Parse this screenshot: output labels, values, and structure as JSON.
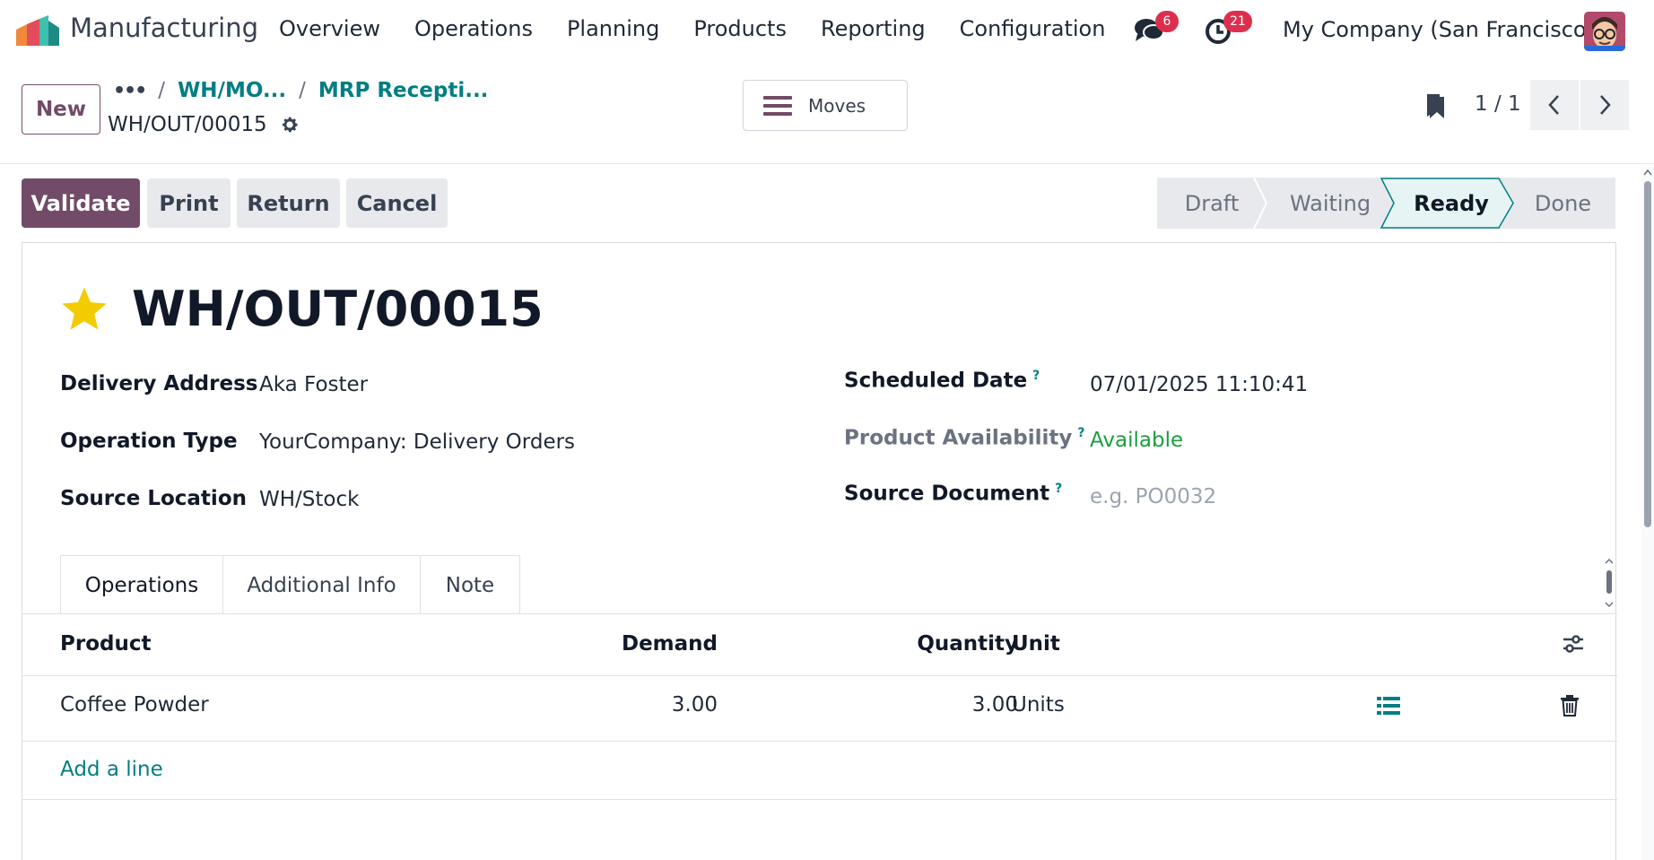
{
  "navbar": {
    "app_name": "Manufacturing",
    "menu": [
      "Overview",
      "Operations",
      "Planning",
      "Products",
      "Reporting",
      "Configuration"
    ],
    "messages_count": "6",
    "activities_count": "21",
    "company": "My Company (San Francisco)",
    "icons": {
      "logo": "manufacturing-logo-icon",
      "messages": "chat-bubbles-icon",
      "activities": "clock-icon"
    }
  },
  "control_panel": {
    "new_label": "New",
    "breadcrumb": {
      "dots": "•••",
      "crumbs": [
        "WH/MO...",
        "MRP Recepti..."
      ]
    },
    "record_name": "WH/OUT/00015",
    "moves_label": "Moves",
    "pager": "1 / 1"
  },
  "actions": {
    "validate": "Validate",
    "print": "Print",
    "return": "Return",
    "cancel": "Cancel"
  },
  "statusbar": {
    "steps": [
      "Draft",
      "Waiting",
      "Ready",
      "Done"
    ],
    "current": "Ready"
  },
  "form": {
    "title": "WH/OUT/00015",
    "starred": true,
    "left_fields": [
      {
        "label": "Delivery Address",
        "value": "Aka Foster"
      },
      {
        "label": "Operation Type",
        "value": "YourCompany: Delivery Orders"
      },
      {
        "label": "Source Location",
        "value": "WH/Stock"
      }
    ],
    "right_fields": [
      {
        "label": "Scheduled Date",
        "help": "?",
        "value": "07/01/2025 11:10:41"
      },
      {
        "label": "Product Availability",
        "help": "?",
        "value": "Available"
      },
      {
        "label": "Source Document",
        "help": "?",
        "placeholder": "e.g. PO0032"
      }
    ],
    "tabs": [
      "Operations",
      "Additional Info",
      "Note"
    ],
    "active_tab": "Operations",
    "table": {
      "headers": {
        "product": "Product",
        "demand": "Demand",
        "quantity": "Quantity",
        "unit": "Unit"
      },
      "rows": [
        {
          "product": "Coffee Powder",
          "demand": "3.00",
          "quantity": "3.00",
          "unit": "Units"
        }
      ],
      "add_line": "Add a line"
    }
  },
  "colors": {
    "primary": "#714b67",
    "link": "#017e84",
    "available": "#1b9e3e",
    "badge": "#dc2f4e"
  }
}
